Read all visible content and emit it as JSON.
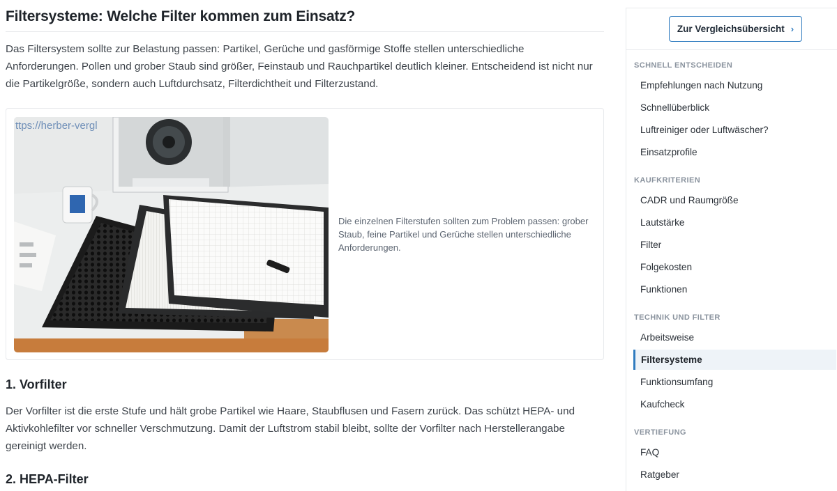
{
  "article": {
    "title": "Filtersysteme: Welche Filter kommen zum Einsatz?",
    "intro_lines": [
      "Das Filtersystem sollte zur Belastung passen: Partikel, Gerüche und gasförmige Stoffe stellen unterschiedliche",
      "Anforderungen. Pollen und grober Staub sind größer, Feinstaub und Rauchpartikel deutlich kleiner. Entscheidend ist nicht nur",
      "die Partikelgröße, sondern auch Luftdurchsatz, Filterdichtheit und Filterzustand."
    ],
    "figure": {
      "watermark": "ttps://herber-vergl",
      "caption_lines": [
        "Die einzelnen Filterstufen sollten zum Problem passen: grober",
        "Staub, feine Partikel und Gerüche stellen unterschiedliche",
        "Anforderungen."
      ]
    },
    "section1": {
      "heading": "1. Vorfilter",
      "lines": [
        "Der Vorfilter ist die erste Stufe und hält grobe Partikel wie Haare, Staubflusen und Fasern zurück. Das schützt HEPA- und",
        "Aktivkohlefilter vor schneller Verschmutzung. Damit der Luftstrom stabil bleibt, sollte der Vorfilter nach Herstellerangabe",
        "gereinigt werden."
      ]
    },
    "section2": {
      "heading": "2. HEPA-Filter"
    }
  },
  "sidebar": {
    "compare_button": "Zur Vergleichsübersicht",
    "sections": [
      {
        "title": "SCHNELL ENTSCHEIDEN",
        "items": [
          "Empfehlungen nach Nutzung",
          "Schnellüberblick",
          "Luftreiniger oder Luftwäscher?",
          "Einsatzprofile"
        ]
      },
      {
        "title": "KAUFKRITERIEN",
        "items": [
          "CADR und Raumgröße",
          "Lautstärke",
          "Filter",
          "Folgekosten",
          "Funktionen"
        ]
      },
      {
        "title": "TECHNIK UND FILTER",
        "items": [
          "Arbeitsweise",
          "Filtersysteme",
          "Funktionsumfang",
          "Kaufcheck"
        ]
      },
      {
        "title": "VERTIEFUNG",
        "items": [
          "FAQ",
          "Ratgeber"
        ]
      }
    ],
    "active_item": "Filtersysteme"
  },
  "colors": {
    "accent": "#2f7bbf",
    "text": "#3d434a",
    "muted": "#8a939e",
    "active_bg": "#eef3f8"
  }
}
